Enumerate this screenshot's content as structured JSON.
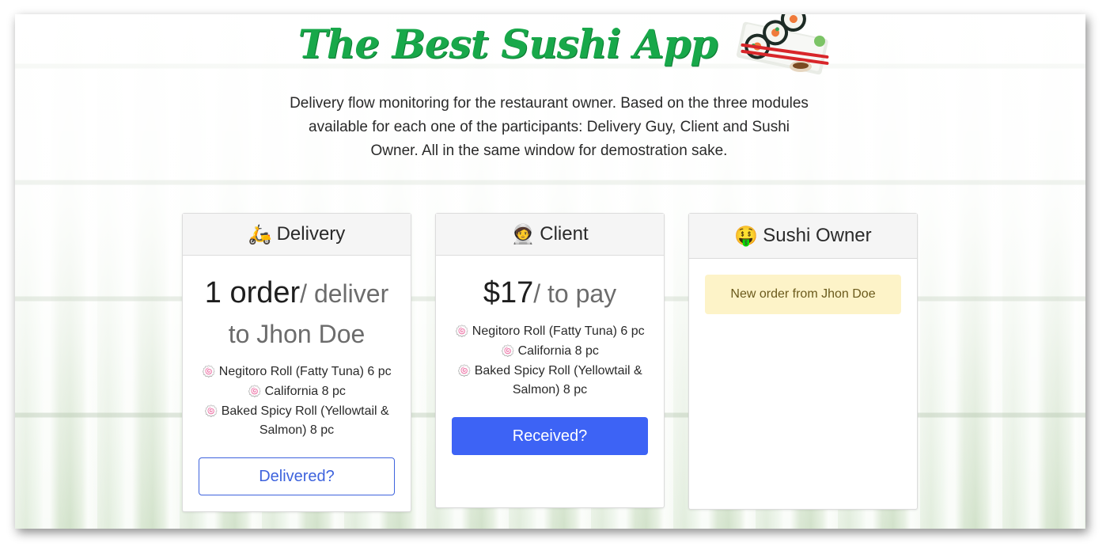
{
  "app": {
    "title": "The Best Sushi App",
    "description": "Delivery flow monitoring for the restaurant owner. Based on the three modules available for each one of the participants: Delivery Guy, Client and Sushi Owner. All in the same window for demostration sake."
  },
  "delivery": {
    "icon": "scooter-icon",
    "icon_glyph": "🛵",
    "title": "Delivery",
    "primary": "1 order",
    "secondary": "/ deliver to Jhon Doe",
    "items": [
      "Negitoro Roll (Fatty Tuna) 6 pc",
      "California 8 pc",
      "Baked Spicy Roll (Yellowtail & Salmon) 8 pc"
    ],
    "item_icon_glyph": "🍥",
    "button_label": "Delivered?"
  },
  "client": {
    "icon": "astronaut-icon",
    "icon_glyph": "🧑‍🚀",
    "title": "Client",
    "primary": "$17",
    "secondary": "/ to pay",
    "items": [
      "Negitoro Roll (Fatty Tuna) 6 pc",
      "California 8 pc",
      "Baked Spicy Roll (Yellowtail & Salmon) 8 pc"
    ],
    "item_icon_glyph": "🍥",
    "button_label": "Received?"
  },
  "owner": {
    "icon": "money-face-icon",
    "icon_glyph": "🤑",
    "title": "Sushi Owner",
    "notice": "New order from Jhon Doe"
  },
  "colors": {
    "title_green": "#18a84a",
    "primary_blue": "#3d63f5",
    "notice_bg": "#fdf3c8"
  }
}
